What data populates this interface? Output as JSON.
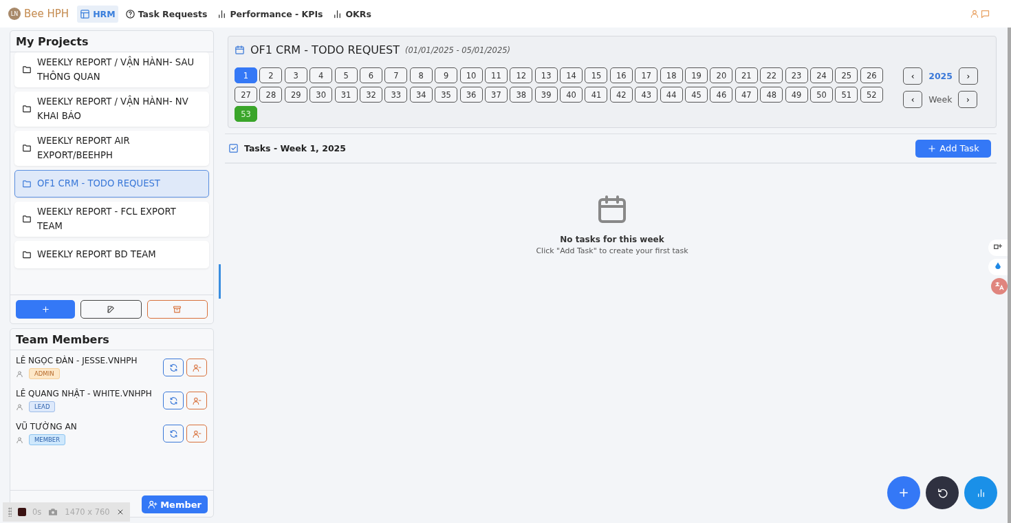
{
  "header": {
    "logo_initials": "LN",
    "brand": "Bee HPH",
    "nav": [
      {
        "label": "HRM",
        "kind": "table",
        "selected": true
      },
      {
        "label": "Task Requests",
        "kind": "help",
        "selected": false
      },
      {
        "label": "Performance - KPIs",
        "kind": "chart",
        "selected": false
      },
      {
        "label": "OKRs",
        "kind": "chart",
        "selected": false
      }
    ]
  },
  "projects": {
    "title": "My Projects",
    "items": [
      {
        "name": "WEEKLY REPORT / VẬN HÀNH- SAU THÔNG QUAN",
        "selected": false
      },
      {
        "name": "WEEKLY REPORT / VẬN HÀNH- NV KHAI BÁO",
        "selected": false
      },
      {
        "name": "WEEKLY REPORT AIR EXPORT/BEEHPH",
        "selected": false
      },
      {
        "name": "OF1 CRM - TODO REQUEST",
        "selected": true
      },
      {
        "name": "WEEKLY REPORT - FCL EXPORT TEAM",
        "selected": false
      },
      {
        "name": "WEEKLY REPORT BD TEAM",
        "selected": false
      }
    ]
  },
  "team": {
    "title": "Team Members",
    "members": [
      {
        "name": "LÊ NGỌC ĐÀN - JESSE.VNHPH",
        "role": "ADMIN",
        "kind": "admin"
      },
      {
        "name": "LÊ QUANG NHẬT - WHITE.VNHPH",
        "role": "LEAD",
        "kind": "lead"
      },
      {
        "name": "VŨ TƯỜNG AN",
        "role": "MEMBER",
        "kind": "member"
      }
    ],
    "add_button": "Member"
  },
  "week_panel": {
    "title": "OF1 CRM - TODO REQUEST",
    "range": "(01/01/2025 - 05/01/2025)",
    "year": "2025",
    "week_label": "Week",
    "prev": "‹",
    "next": "›",
    "weeks": [
      {
        "label": "1",
        "selected": true,
        "current": false
      },
      {
        "label": "2",
        "selected": false,
        "current": false
      },
      {
        "label": "3",
        "selected": false,
        "current": false
      },
      {
        "label": "4",
        "selected": false,
        "current": false
      },
      {
        "label": "5",
        "selected": false,
        "current": false
      },
      {
        "label": "6",
        "selected": false,
        "current": false
      },
      {
        "label": "7",
        "selected": false,
        "current": false
      },
      {
        "label": "8",
        "selected": false,
        "current": false
      },
      {
        "label": "9",
        "selected": false,
        "current": false
      },
      {
        "label": "10",
        "selected": false,
        "current": false
      },
      {
        "label": "11",
        "selected": false,
        "current": false
      },
      {
        "label": "12",
        "selected": false,
        "current": false
      },
      {
        "label": "13",
        "selected": false,
        "current": false
      },
      {
        "label": "14",
        "selected": false,
        "current": false
      },
      {
        "label": "15",
        "selected": false,
        "current": false
      },
      {
        "label": "16",
        "selected": false,
        "current": false
      },
      {
        "label": "17",
        "selected": false,
        "current": false
      },
      {
        "label": "18",
        "selected": false,
        "current": false
      },
      {
        "label": "19",
        "selected": false,
        "current": false
      },
      {
        "label": "20",
        "selected": false,
        "current": false
      },
      {
        "label": "21",
        "selected": false,
        "current": false
      },
      {
        "label": "22",
        "selected": false,
        "current": false
      },
      {
        "label": "23",
        "selected": false,
        "current": false
      },
      {
        "label": "24",
        "selected": false,
        "current": false
      },
      {
        "label": "25",
        "selected": false,
        "current": false
      },
      {
        "label": "26",
        "selected": false,
        "current": false
      },
      {
        "label": "27",
        "selected": false,
        "current": false
      },
      {
        "label": "28",
        "selected": false,
        "current": false
      },
      {
        "label": "29",
        "selected": false,
        "current": false
      },
      {
        "label": "30",
        "selected": false,
        "current": false
      },
      {
        "label": "31",
        "selected": false,
        "current": false
      },
      {
        "label": "32",
        "selected": false,
        "current": false
      },
      {
        "label": "33",
        "selected": false,
        "current": false
      },
      {
        "label": "34",
        "selected": false,
        "current": false
      },
      {
        "label": "35",
        "selected": false,
        "current": false
      },
      {
        "label": "36",
        "selected": false,
        "current": false
      },
      {
        "label": "37",
        "selected": false,
        "current": false
      },
      {
        "label": "38",
        "selected": false,
        "current": false
      },
      {
        "label": "39",
        "selected": false,
        "current": false
      },
      {
        "label": "40",
        "selected": false,
        "current": false
      },
      {
        "label": "41",
        "selected": false,
        "current": false
      },
      {
        "label": "42",
        "selected": false,
        "current": false
      },
      {
        "label": "43",
        "selected": false,
        "current": false
      },
      {
        "label": "44",
        "selected": false,
        "current": false
      },
      {
        "label": "45",
        "selected": false,
        "current": false
      },
      {
        "label": "46",
        "selected": false,
        "current": false
      },
      {
        "label": "47",
        "selected": false,
        "current": false
      },
      {
        "label": "48",
        "selected": false,
        "current": false
      },
      {
        "label": "49",
        "selected": false,
        "current": false
      },
      {
        "label": "50",
        "selected": false,
        "current": false
      },
      {
        "label": "51",
        "selected": false,
        "current": false
      },
      {
        "label": "52",
        "selected": false,
        "current": false
      },
      {
        "label": "53",
        "selected": false,
        "current": true
      }
    ]
  },
  "tasks": {
    "title": "Tasks - Week 1, 2025",
    "add_button": "Add Task",
    "empty_title": "No tasks for this week",
    "empty_hint": "Click \"Add Task\" to create your first task"
  },
  "recorder_toolbar": {
    "timer": "0s",
    "size": "1470 x 760"
  }
}
